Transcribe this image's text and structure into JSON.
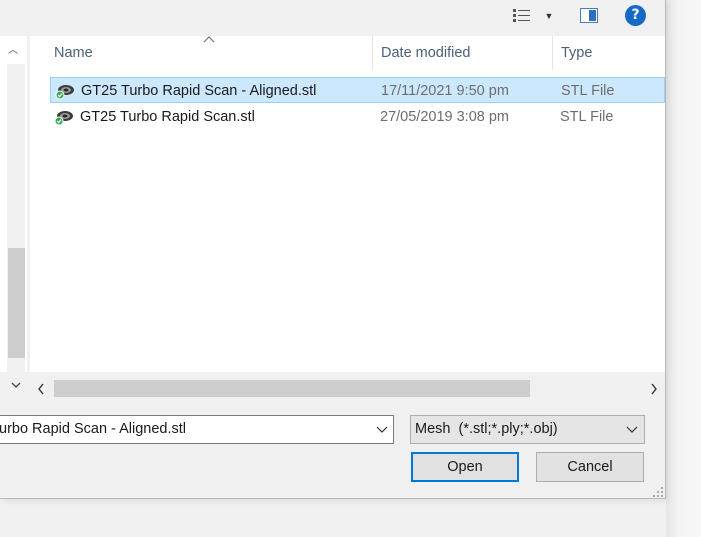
{
  "columns": {
    "name": "Name",
    "date_modified": "Date modified",
    "type": "Type"
  },
  "files": [
    {
      "name": "GT25 Turbo Rapid Scan - Aligned.stl",
      "date": "17/11/2021 9:50 pm",
      "type": "STL File",
      "selected": true
    },
    {
      "name": "GT25 Turbo Rapid Scan.stl",
      "date": "27/05/2019 3:08 pm",
      "type": "STL File",
      "selected": false
    }
  ],
  "filename_field": {
    "value": "urbo Rapid Scan - Aligned.stl"
  },
  "filter": {
    "selected": "Mesh  (*.stl;*.ply;*.obj)"
  },
  "buttons": {
    "open": "Open",
    "cancel": "Cancel"
  },
  "toolbar": {
    "help": "?"
  },
  "colors": {
    "selection": "#cce8ff",
    "accent": "#0078d7",
    "header_text": "#4c607a"
  },
  "icons": {
    "view": "view-menu-icon",
    "preview": "preview-pane-icon",
    "help": "help-icon",
    "file": "stl-file-icon"
  }
}
